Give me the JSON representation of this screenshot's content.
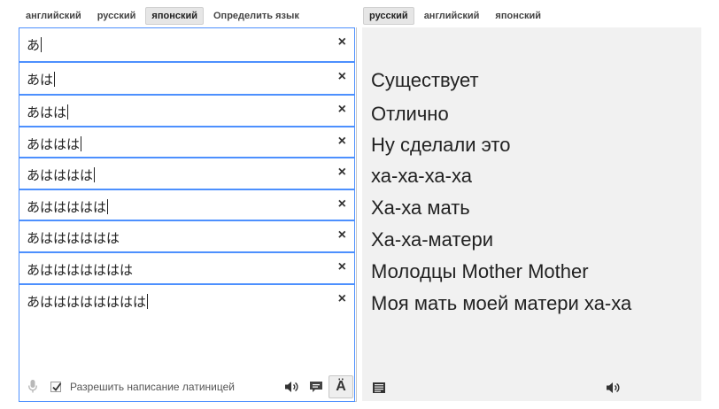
{
  "source_languages": [
    "английский",
    "русский",
    "японский",
    "Определить язык"
  ],
  "source_selected": "японский",
  "target_languages": [
    "русский",
    "английский",
    "японский"
  ],
  "target_selected": "русский",
  "inputs": [
    {
      "text": "あ",
      "clear": "×"
    },
    {
      "text": "あは",
      "clear": "×"
    },
    {
      "text": "あはは",
      "clear": "×"
    },
    {
      "text": "あははは",
      "clear": "×"
    },
    {
      "text": "あはははは",
      "clear": "×"
    },
    {
      "text": "あははははは",
      "clear": "×"
    },
    {
      "text": "あはははははは",
      "clear": "×"
    },
    {
      "text": "あははははははは",
      "clear": "×"
    },
    {
      "text": "あはははははははは",
      "clear": "×"
    }
  ],
  "translations": [
    "Существует",
    "Отлично",
    "Ну сделали это",
    "ха-ха-ха-ха",
    "Ха-ха мать",
    "Ха-ха-матери",
    "Молодцы Mother Mother",
    "Моя мать моей матери ха-ха"
  ],
  "footer": {
    "checkbox_label": "Разрешить написание латиницей",
    "checkbox_checked": true,
    "keyboard_label": "Ä"
  },
  "icons": {
    "mic": "microphone-icon",
    "listen": "speaker-icon",
    "chat": "chat-bubble-icon",
    "list": "list-icon"
  },
  "colors": {
    "input_border": "#4d90fe",
    "output_background": "#f1f1f1",
    "selected_tab": "#e6e6e6"
  }
}
